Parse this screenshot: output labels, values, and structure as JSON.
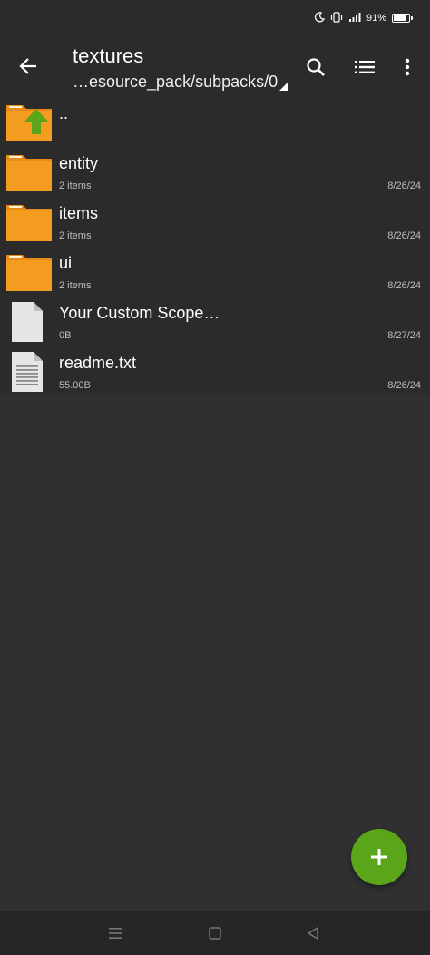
{
  "status_bar": {
    "battery_text": "91%",
    "battery_level": 0.91,
    "icons": [
      "moon-icon",
      "vibrate-icon",
      "signal-icon",
      "battery-icon"
    ]
  },
  "toolbar": {
    "title": "textures",
    "path": "…esource_pack/subpacks/0",
    "icons": [
      "back-arrow-icon",
      "search-icon",
      "list-view-icon",
      "more-vert-icon"
    ]
  },
  "files": [
    {
      "name": "..",
      "meta": "",
      "date": "",
      "icon": "parent-folder-icon"
    },
    {
      "name": "entity",
      "meta": "2 items",
      "date": "8/26/24",
      "icon": "folder-icon"
    },
    {
      "name": "items",
      "meta": "2 items",
      "date": "8/26/24",
      "icon": "folder-icon"
    },
    {
      "name": "ui",
      "meta": "2 items",
      "date": "8/26/24",
      "icon": "folder-icon"
    },
    {
      "name": "Your Custom Scope…",
      "meta": "0B",
      "date": "8/27/24",
      "icon": "file-icon"
    },
    {
      "name": "readme.txt",
      "meta": "55.00B",
      "date": "8/26/24",
      "icon": "text-file-icon"
    }
  ],
  "fab": {
    "icon": "plus-icon",
    "color": "#5aa51a"
  },
  "nav_bar": {
    "icons": [
      "menu-nav-icon",
      "home-nav-icon",
      "back-nav-icon"
    ]
  },
  "colors": {
    "background": "#303030",
    "toolbar": "#2b2b2b",
    "folder": "#f39c1f",
    "accent": "#5aa51a"
  }
}
